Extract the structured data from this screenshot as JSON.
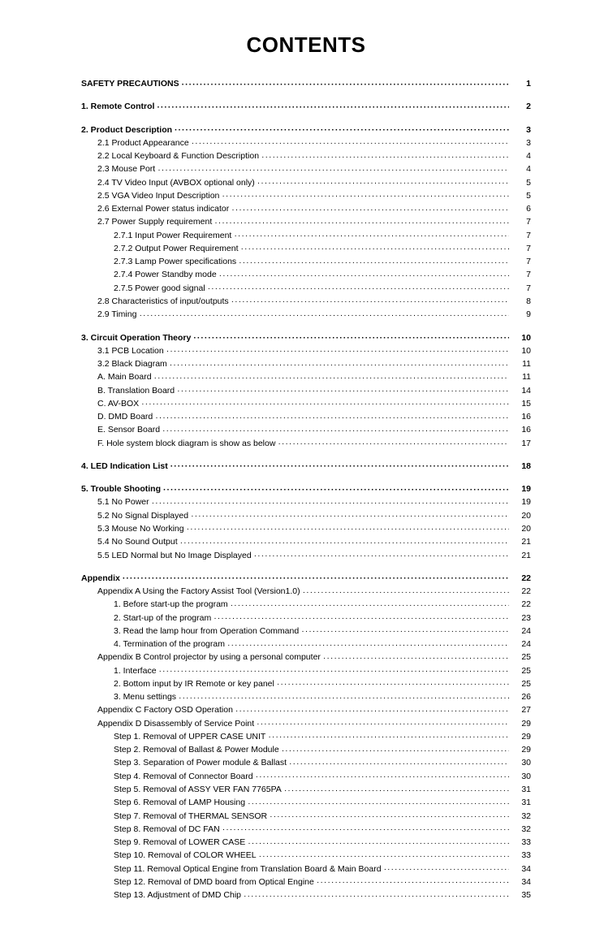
{
  "title": "CONTENTS",
  "entries": [
    {
      "label": "SAFETY PRECAUTIONS",
      "page": "1",
      "indent": 0,
      "bold": true,
      "gapAfter": true
    },
    {
      "label": "1. Remote Control",
      "page": "2",
      "indent": 0,
      "bold": true,
      "gapAfter": true
    },
    {
      "label": "2. Product Description",
      "page": "3",
      "indent": 0,
      "bold": true
    },
    {
      "label": "2.1 Product Appearance",
      "page": "3",
      "indent": 1
    },
    {
      "label": "2.2 Local Keyboard & Function Description",
      "page": "4",
      "indent": 1
    },
    {
      "label": "2.3 Mouse Port",
      "page": "4",
      "indent": 1
    },
    {
      "label": "2.4 TV Video Input (AVBOX optional only)",
      "page": "5",
      "indent": 1
    },
    {
      "label": "2.5 VGA Video Input Description",
      "page": "5",
      "indent": 1
    },
    {
      "label": "2.6 External Power status indicator",
      "page": "6",
      "indent": 1
    },
    {
      "label": "2.7 Power Supply requirement",
      "page": "7",
      "indent": 1
    },
    {
      "label": "2.7.1 Input Power Requirement",
      "page": "7",
      "indent": 2
    },
    {
      "label": "2.7.2 Output Power Requirement",
      "page": "7",
      "indent": 2
    },
    {
      "label": "2.7.3 Lamp Power specifications",
      "page": "7",
      "indent": 2
    },
    {
      "label": "2.7.4 Power Standby mode",
      "page": "7",
      "indent": 2
    },
    {
      "label": "2.7.5 Power good signal",
      "page": "7",
      "indent": 2
    },
    {
      "label": "2.8 Characteristics of input/outputs",
      "page": "8",
      "indent": 1
    },
    {
      "label": "2.9 Timing",
      "page": "9",
      "indent": 1,
      "gapAfter": true
    },
    {
      "label": "3. Circuit Operation Theory",
      "page": "10",
      "indent": 0,
      "bold": true
    },
    {
      "label": "3.1 PCB Location",
      "page": "10",
      "indent": 1
    },
    {
      "label": "3.2 Black Diagram",
      "page": "11",
      "indent": 1
    },
    {
      "label": "A. Main Board",
      "page": "11",
      "indent": 1
    },
    {
      "label": "B. Translation Board",
      "page": "14",
      "indent": 1
    },
    {
      "label": "C. AV-BOX",
      "page": "15",
      "indent": 1
    },
    {
      "label": "D. DMD Board",
      "page": "16",
      "indent": 1
    },
    {
      "label": "E. Sensor Board",
      "page": "16",
      "indent": 1
    },
    {
      "label": "F. Hole system block diagram is show as below",
      "page": "17",
      "indent": 1,
      "gapAfter": true
    },
    {
      "label": "4. LED Indication List",
      "page": "18",
      "indent": 0,
      "bold": true,
      "gapAfter": true
    },
    {
      "label": "5. Trouble Shooting",
      "page": "19",
      "indent": 0,
      "bold": true
    },
    {
      "label": "5.1 No Power",
      "page": "19",
      "indent": 1
    },
    {
      "label": "5.2 No Signal Displayed",
      "page": "20",
      "indent": 1
    },
    {
      "label": "5.3 Mouse No Working",
      "page": "20",
      "indent": 1
    },
    {
      "label": "5.4 No Sound Output",
      "page": "21",
      "indent": 1
    },
    {
      "label": "5.5 LED Normal but No Image Displayed",
      "page": "21",
      "indent": 1,
      "gapAfter": true
    },
    {
      "label": "Appendix",
      "page": "22",
      "indent": 0,
      "bold": true
    },
    {
      "label": "Appendix A Using the Factory Assist Tool (Version1.0)",
      "page": "22",
      "indent": 1
    },
    {
      "label": "1. Before start-up the program",
      "page": "22",
      "indent": 2
    },
    {
      "label": "2. Start-up of the program",
      "page": "23",
      "indent": 2
    },
    {
      "label": "3. Read the lamp hour from Operation Command",
      "page": "24",
      "indent": 2
    },
    {
      "label": "4. Termination of the program",
      "page": "24",
      "indent": 2
    },
    {
      "label": "Appendix B Control projector by using a personal computer",
      "page": "25",
      "indent": 1
    },
    {
      "label": "1. Interface",
      "page": "25",
      "indent": 2
    },
    {
      "label": "2. Bottom input by IR Remote or key panel",
      "page": "25",
      "indent": 2
    },
    {
      "label": "3. Menu settings",
      "page": "26",
      "indent": 2
    },
    {
      "label": "Appendix C Factory OSD Operation",
      "page": "27",
      "indent": 1
    },
    {
      "label": "Appendix D Disassembly of Service Point",
      "page": "29",
      "indent": 1
    },
    {
      "label": "Step 1. Removal of UPPER CASE UNIT",
      "page": "29",
      "indent": 2
    },
    {
      "label": "Step 2. Removal of Ballast & Power Module",
      "page": "29",
      "indent": 2
    },
    {
      "label": "Step 3. Separation of Power module & Ballast",
      "page": "30",
      "indent": 2
    },
    {
      "label": "Step 4. Removal of Connector Board",
      "page": "30",
      "indent": 2
    },
    {
      "label": "Step 5. Removal of ASSY VER FAN 7765PA",
      "page": "31",
      "indent": 2
    },
    {
      "label": "Step 6. Removal of LAMP Housing",
      "page": "31",
      "indent": 2
    },
    {
      "label": "Step 7. Removal of THERMAL SENSOR",
      "page": "32",
      "indent": 2
    },
    {
      "label": "Step 8. Removal of DC FAN",
      "page": "32",
      "indent": 2
    },
    {
      "label": "Step 9. Removal of LOWER CASE",
      "page": "33",
      "indent": 2
    },
    {
      "label": "Step 10. Removal of COLOR WHEEL",
      "page": "33",
      "indent": 2
    },
    {
      "label": "Step 11. Removal Optical Engine from Translation Board & Main Board",
      "page": "34",
      "indent": 2
    },
    {
      "label": "Step 12. Removal of DMD board from Optical Engine",
      "page": "34",
      "indent": 2
    },
    {
      "label": "Step 13. Adjustment of DMD Chip",
      "page": "35",
      "indent": 2
    }
  ]
}
